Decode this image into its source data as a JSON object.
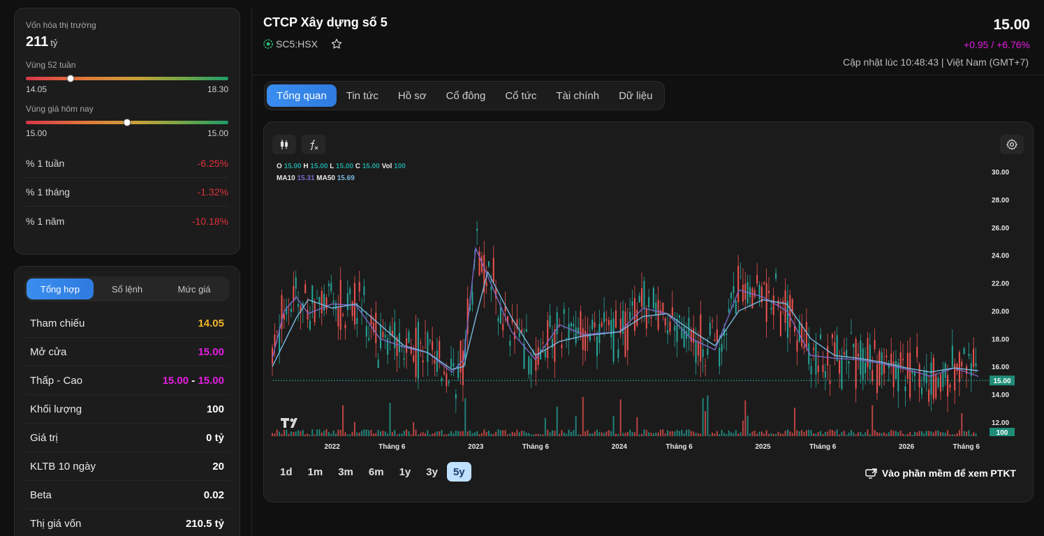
{
  "left": {
    "market_cap_label": "Vốn hóa thị trường",
    "market_cap_value": "211",
    "market_cap_unit": "tỷ",
    "range52_label": "Vùng 52 tuần",
    "range52_low": "14.05",
    "range52_high": "18.30",
    "range52_position": 0.22,
    "today_label": "Vùng giá hôm nay",
    "today_low": "15.00",
    "today_high": "15.00",
    "today_position": 0.5,
    "performance": [
      {
        "label": "% 1 tuần",
        "value": "-6.25%"
      },
      {
        "label": "% 1 tháng",
        "value": "-1.32%"
      },
      {
        "label": "% 1 năm",
        "value": "-10.18%"
      }
    ]
  },
  "summary": {
    "tabs": [
      "Tổng hợp",
      "Sổ lệnh",
      "Mức giá"
    ],
    "rows": [
      {
        "label": "Tham chiếu",
        "value": "14.05"
      },
      {
        "label": "Mở cửa",
        "value": "15.00"
      },
      {
        "label": "Thấp - Cao",
        "low": "15.00",
        "sep": "-",
        "high": "15.00"
      },
      {
        "label": "Khối lượng",
        "value": "100"
      },
      {
        "label": "Giá trị",
        "value": "0 tỷ"
      },
      {
        "label": "KLTB 10 ngày",
        "value": "20"
      },
      {
        "label": "Beta",
        "value": "0.02"
      },
      {
        "label": "Thị giá vốn",
        "value": "210.5 tỷ"
      }
    ]
  },
  "header": {
    "company": "CTCP Xây dựng số 5",
    "ticker": "SC5:HSX",
    "price": "15.00",
    "change": "+0.95 / +6.76%",
    "updated": "Cập nhật lúc 10:48:43 | Việt Nam (GMT+7)"
  },
  "tabs": [
    "Tổng quan",
    "Tin tức",
    "Hồ sơ",
    "Cổ đông",
    "Cổ tức",
    "Tài chính",
    "Dữ liệu"
  ],
  "chart": {
    "legend_o": "O",
    "legend_o_v": "15.00",
    "legend_h": "H",
    "legend_h_v": "15.00",
    "legend_l": "L",
    "legend_l_v": "15.00",
    "legend_c": "C",
    "legend_c_v": "15.00",
    "legend_vol": "Vol",
    "legend_vol_v": "100",
    "legend_ma10": "MA10",
    "legend_ma10_v": "15.31",
    "legend_ma50": "MA50",
    "legend_ma50_v": "15.69",
    "y_ticks": [
      "30.00",
      "28.00",
      "26.00",
      "24.00",
      "22.00",
      "20.00",
      "18.00",
      "16.00",
      "14.00",
      "12.00"
    ],
    "x_ticks": [
      "2022",
      "Tháng 6",
      "2023",
      "Tháng 6",
      "2024",
      "Tháng 6",
      "2025",
      "Tháng 6",
      "2026",
      "Tháng 6"
    ],
    "last_price_tag": "15.00",
    "last_vol_tag": "100",
    "ranges": [
      "1d",
      "1m",
      "3m",
      "6m",
      "1y",
      "3y",
      "5y"
    ],
    "active_range": "5y",
    "ptkt_label": "Vào phần mềm để xem PTKT",
    "colors": {
      "up": "#26a69a",
      "down": "#ef5350",
      "ma10": "#7b68c8",
      "ma50": "#7ab8e0"
    }
  },
  "chart_data": {
    "type": "line",
    "title": "",
    "series": [
      {
        "name": "MA10",
        "points": [
          {
            "x": "2021-08",
            "y": 16.6
          },
          {
            "x": "2021-09",
            "y": 20.0
          },
          {
            "x": "2021-10",
            "y": 21.0
          },
          {
            "x": "2021-11",
            "y": 19.8
          },
          {
            "x": "2022-01",
            "y": 20.5
          },
          {
            "x": "2022-03",
            "y": 20.4
          },
          {
            "x": "2022-05",
            "y": 18.0
          },
          {
            "x": "2022-07",
            "y": 17.4
          },
          {
            "x": "2022-09",
            "y": 17.0
          },
          {
            "x": "2022-11",
            "y": 15.6
          },
          {
            "x": "2022-12",
            "y": 16.5
          },
          {
            "x": "2023-01",
            "y": 24.5
          },
          {
            "x": "2023-02",
            "y": 22.5
          },
          {
            "x": "2023-04",
            "y": 18.5
          },
          {
            "x": "2023-06",
            "y": 16.5
          },
          {
            "x": "2023-08",
            "y": 19.0
          },
          {
            "x": "2023-10",
            "y": 18.3
          },
          {
            "x": "2024-01",
            "y": 18.5
          },
          {
            "x": "2024-03",
            "y": 20.2
          },
          {
            "x": "2024-05",
            "y": 19.8
          },
          {
            "x": "2024-07",
            "y": 18.0
          },
          {
            "x": "2024-09",
            "y": 17.2
          },
          {
            "x": "2024-11",
            "y": 21.5
          },
          {
            "x": "2025-01",
            "y": 21.0
          },
          {
            "x": "2025-03",
            "y": 20.0
          },
          {
            "x": "2025-05",
            "y": 16.8
          },
          {
            "x": "2025-07",
            "y": 16.6
          },
          {
            "x": "2025-09",
            "y": 16.5
          },
          {
            "x": "2025-11",
            "y": 16.2
          },
          {
            "x": "2026-01",
            "y": 15.8
          },
          {
            "x": "2026-03",
            "y": 15.3
          },
          {
            "x": "2026-05",
            "y": 15.9
          },
          {
            "x": "2026-07",
            "y": 15.3
          }
        ]
      },
      {
        "name": "MA50",
        "points": [
          {
            "x": "2021-08",
            "y": 16.0
          },
          {
            "x": "2021-10",
            "y": 19.5
          },
          {
            "x": "2021-11",
            "y": 20.8
          },
          {
            "x": "2022-01",
            "y": 20.2
          },
          {
            "x": "2022-03",
            "y": 20.5
          },
          {
            "x": "2022-05",
            "y": 19.0
          },
          {
            "x": "2022-07",
            "y": 17.5
          },
          {
            "x": "2022-09",
            "y": 17.0
          },
          {
            "x": "2022-11",
            "y": 15.8
          },
          {
            "x": "2022-12",
            "y": 16.0
          },
          {
            "x": "2023-01",
            "y": 19.5
          },
          {
            "x": "2023-02",
            "y": 22.8
          },
          {
            "x": "2023-04",
            "y": 19.5
          },
          {
            "x": "2023-06",
            "y": 16.8
          },
          {
            "x": "2023-08",
            "y": 17.8
          },
          {
            "x": "2023-10",
            "y": 18.2
          },
          {
            "x": "2024-01",
            "y": 18.5
          },
          {
            "x": "2024-03",
            "y": 19.6
          },
          {
            "x": "2024-05",
            "y": 19.8
          },
          {
            "x": "2024-07",
            "y": 18.6
          },
          {
            "x": "2024-09",
            "y": 17.5
          },
          {
            "x": "2024-11",
            "y": 20.0
          },
          {
            "x": "2025-01",
            "y": 20.8
          },
          {
            "x": "2025-03",
            "y": 20.5
          },
          {
            "x": "2025-05",
            "y": 18.0
          },
          {
            "x": "2025-07",
            "y": 16.8
          },
          {
            "x": "2025-09",
            "y": 16.6
          },
          {
            "x": "2025-11",
            "y": 16.3
          },
          {
            "x": "2026-01",
            "y": 15.9
          },
          {
            "x": "2026-03",
            "y": 15.6
          },
          {
            "x": "2026-05",
            "y": 15.9
          },
          {
            "x": "2026-07",
            "y": 15.7
          }
        ]
      }
    ],
    "current_price": 15.0,
    "ylim": [
      11,
      30.5
    ],
    "xlim": [
      "2021-08",
      "2026-08"
    ]
  }
}
